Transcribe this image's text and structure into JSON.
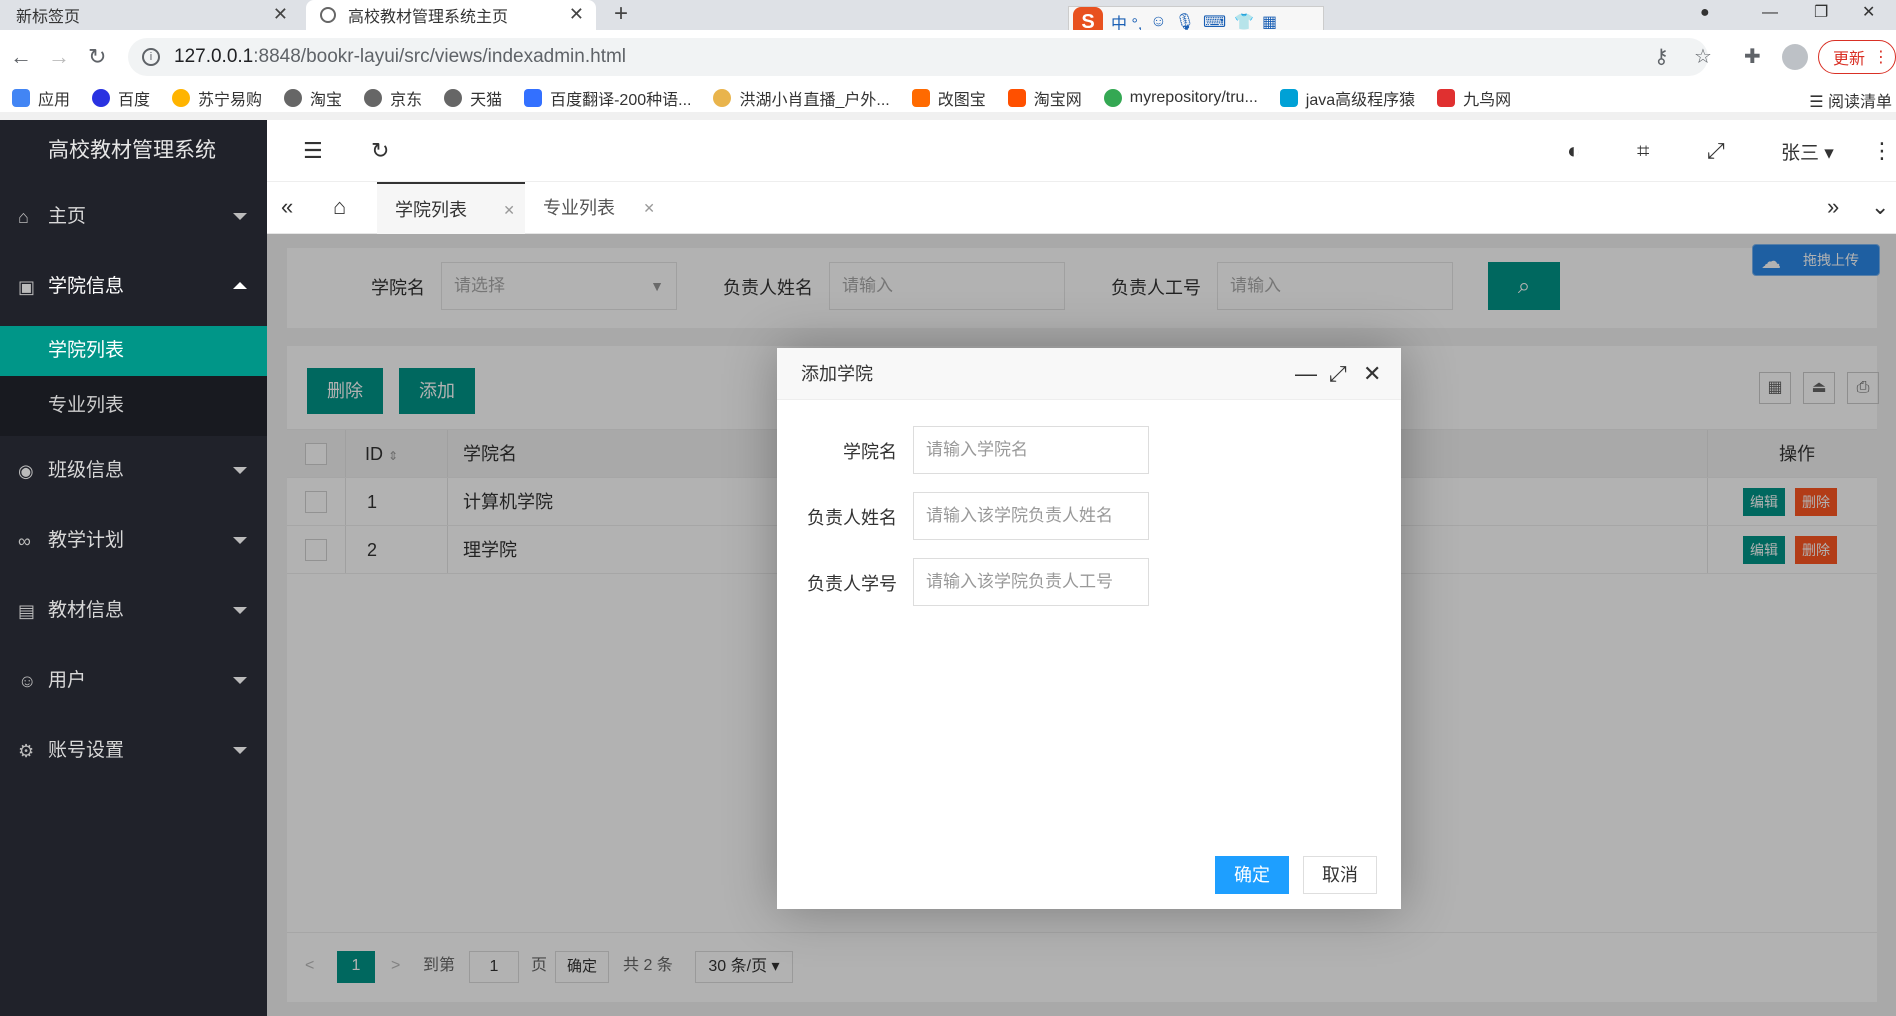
{
  "browser": {
    "tabs": [
      {
        "title": "新标签页"
      },
      {
        "title": "高校教材管理系统主页"
      }
    ],
    "url_host": "127.0.0.1",
    "url_path": ":8848/bookr-layui/src/views/indexadmin.html",
    "update_label": "更新",
    "bookmarks": [
      "应用",
      "百度",
      "苏宁易购",
      "淘宝",
      "京东",
      "天猫",
      "百度翻译-200种语...",
      "洪湖小肖直播_户外...",
      "改图宝",
      "淘宝网",
      "myrepository/tru...",
      "java高级程序猿",
      "九鸟网"
    ],
    "reading_list": "阅读清单",
    "ime": {
      "logo": "S",
      "text": "中 °,"
    }
  },
  "app": {
    "title": "高校教材管理系统",
    "user": "张三",
    "menu": [
      {
        "label": "主页"
      },
      {
        "label": "学院信息"
      },
      {
        "label": "班级信息"
      },
      {
        "label": "教学计划"
      },
      {
        "label": "教材信息"
      },
      {
        "label": "用户"
      },
      {
        "label": "账号设置"
      }
    ],
    "submenu": [
      {
        "label": "学院列表"
      },
      {
        "label": "专业列表"
      }
    ],
    "page_tabs": [
      {
        "label": "学院列表"
      },
      {
        "label": "专业列表"
      }
    ]
  },
  "search": {
    "college_label": "学院名",
    "college_placeholder": "请选择",
    "leader_name_label": "负责人姓名",
    "leader_name_placeholder": "请输入",
    "leader_id_label": "负责人工号",
    "leader_id_placeholder": "请输入"
  },
  "upload_label": "拖拽上传",
  "table": {
    "delete_label": "删除",
    "add_label": "添加",
    "col_id": "ID",
    "col_name": "学院名",
    "col_ops": "操作",
    "rows": [
      {
        "id": "1",
        "name": "计算机学院",
        "edit": "编辑",
        "del": "删除"
      },
      {
        "id": "2",
        "name": "理学院",
        "edit": "编辑",
        "del": "删除"
      }
    ]
  },
  "pager": {
    "current": "1",
    "goto_label": "到第",
    "goto_value": "1",
    "page_unit": "页",
    "confirm": "确定",
    "total": "共 2 条",
    "per_page": "30 条/页"
  },
  "dialog": {
    "title": "添加学院",
    "fields": [
      {
        "label": "学院名",
        "placeholder": "请输入学院名"
      },
      {
        "label": "负责人姓名",
        "placeholder": "请输入该学院负责人姓名"
      },
      {
        "label": "负责人学号",
        "placeholder": "请输入该学院负责人工号"
      }
    ],
    "ok": "确定",
    "cancel": "取消"
  },
  "colors": {
    "accent": "#009688",
    "primary": "#1e9fff",
    "danger": "#ff5722",
    "sidebar": "#20222a"
  }
}
